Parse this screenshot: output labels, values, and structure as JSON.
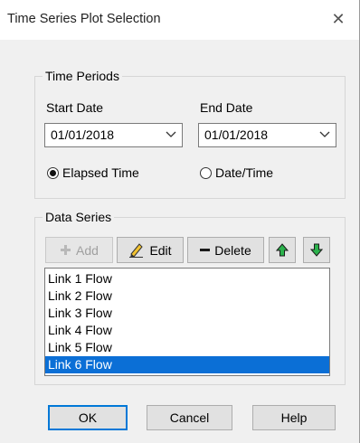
{
  "dialog": {
    "title": "Time Series Plot Selection",
    "close_glyph": "✕"
  },
  "time_periods": {
    "group_title": "Time Periods",
    "start_label": "Start Date",
    "start_value": "01/01/2018",
    "end_label": "End Date",
    "end_value": "01/01/2018",
    "radio_elapsed": "Elapsed Time",
    "radio_datetime": "Date/Time",
    "selected_radio": "Elapsed Time"
  },
  "data_series": {
    "group_title": "Data Series",
    "toolbar": {
      "add_label": "Add",
      "edit_label": "Edit",
      "delete_label": "Delete"
    },
    "items": [
      {
        "label": "Link 1 Flow"
      },
      {
        "label": "Link 2 Flow"
      },
      {
        "label": "Link 3 Flow"
      },
      {
        "label": "Link 4 Flow"
      },
      {
        "label": "Link 5 Flow"
      },
      {
        "label": "Link 6 Flow"
      }
    ],
    "selected_item": "Link 6 Flow"
  },
  "buttons": {
    "ok": "OK",
    "cancel": "Cancel",
    "help": "Help"
  },
  "colors": {
    "selection": "#0b6fd6",
    "arrow_green": "#2bb24c",
    "default_button_border": "#0078d7"
  },
  "icons": {
    "add": "plus-icon",
    "edit": "pencil-icon",
    "delete": "minus-icon",
    "move_up": "arrow-up-icon",
    "move_down": "arrow-down-icon",
    "combo": "chevron-down-icon"
  }
}
